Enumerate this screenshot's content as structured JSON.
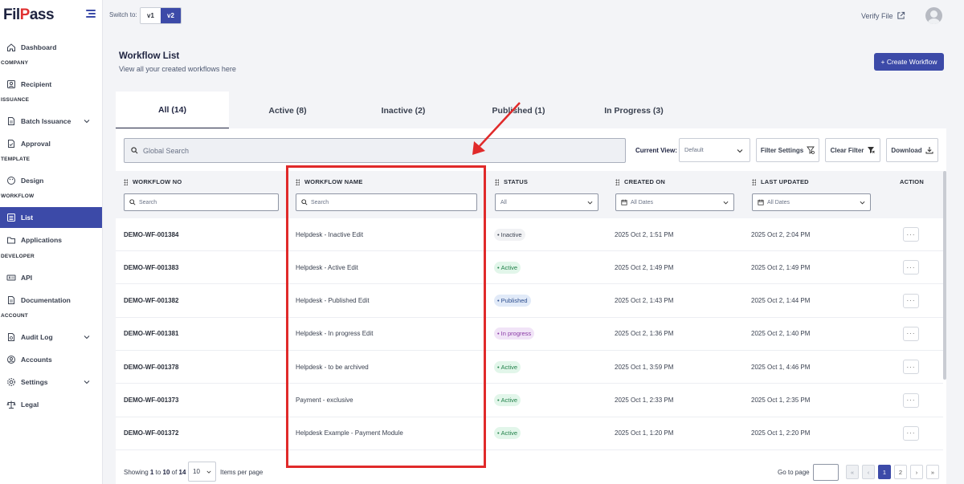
{
  "app": {
    "logo_main": "Fil",
    "logo_v": "P",
    "logo_rest": "ass"
  },
  "topbar": {
    "switch_label": "Switch to:",
    "versions": [
      "v1",
      "v2"
    ],
    "active_version": "v2",
    "verify_label": "Verify File"
  },
  "sidebar": {
    "items": [
      {
        "label": "Dashboard",
        "icon": "home-icon"
      },
      {
        "section": "COMPANY"
      },
      {
        "label": "Recipient",
        "icon": "recipient-icon"
      },
      {
        "section": "ISSUANCE"
      },
      {
        "label": "Batch Issuance",
        "icon": "document-icon",
        "expandable": true
      },
      {
        "label": "Approval",
        "icon": "document-check-icon"
      },
      {
        "section": "TEMPLATE"
      },
      {
        "label": "Design",
        "icon": "palette-icon"
      },
      {
        "section": "WORKFLOW"
      },
      {
        "label": "List",
        "icon": "list-icon",
        "active": true
      },
      {
        "label": "Applications",
        "icon": "folder-icon"
      },
      {
        "section": "DEVELOPER"
      },
      {
        "label": "API",
        "icon": "api-icon"
      },
      {
        "label": "Documentation",
        "icon": "document-icon"
      },
      {
        "section": "ACCOUNT"
      },
      {
        "label": "Audit Log",
        "icon": "audit-icon",
        "expandable": true
      },
      {
        "label": "Accounts",
        "icon": "accounts-icon"
      },
      {
        "label": "Settings",
        "icon": "gear-icon",
        "expandable": true
      },
      {
        "label": "Legal",
        "icon": "scale-icon"
      }
    ]
  },
  "header": {
    "title": "Workflow List",
    "subtitle": "View all your created workflows here",
    "create_label": "+ Create Workflow"
  },
  "tabs": [
    {
      "label": "All (14)",
      "active": true
    },
    {
      "label": "Active (8)"
    },
    {
      "label": "Inactive (2)"
    },
    {
      "label": "Published (1)"
    },
    {
      "label": "In Progress (3)"
    }
  ],
  "toolbar": {
    "search_placeholder": "Global Search",
    "current_view_label": "Current View:",
    "current_view_value": "Default",
    "filter_settings_label": "Filter Settings",
    "clear_filter_label": "Clear Filter",
    "download_label": "Download"
  },
  "table": {
    "columns": [
      "WORKFLOW NO",
      "WORKFLOW NAME",
      "STATUS",
      "CREATED ON",
      "LAST UPDATED",
      "ACTION"
    ],
    "filters": {
      "no_placeholder": "Search",
      "name_placeholder": "Search",
      "status_value": "All",
      "created_value": "All Dates",
      "updated_value": "All Dates"
    },
    "rows": [
      {
        "no": "DEMO-WF-001384",
        "name": "Helpdesk - Inactive Edit",
        "status": "Inactive",
        "status_kind": "inactive",
        "created": "2025 Oct 2, 1:51 PM",
        "updated": "2025 Oct 2, 2:04 PM",
        "action": "···"
      },
      {
        "no": "DEMO-WF-001383",
        "name": "Helpdesk - Active Edit",
        "status": "Active",
        "status_kind": "active",
        "created": "2025 Oct 2, 1:49 PM",
        "updated": "2025 Oct 2, 1:49 PM",
        "action": "···"
      },
      {
        "no": "DEMO-WF-001382",
        "name": "Helpdesk - Published Edit",
        "status": "Published",
        "status_kind": "published",
        "created": "2025 Oct 2, 1:43 PM",
        "updated": "2025 Oct 2, 1:44 PM",
        "action": "···"
      },
      {
        "no": "DEMO-WF-001381",
        "name": "Helpdesk - In progress Edit",
        "status": "In progress",
        "status_kind": "progress",
        "created": "2025 Oct 2, 1:36 PM",
        "updated": "2025 Oct 2, 1:40 PM",
        "action": "···"
      },
      {
        "no": "DEMO-WF-001378",
        "name": "Helpdesk - to be archived",
        "status": "Active",
        "status_kind": "active",
        "created": "2025 Oct 1, 3:59 PM",
        "updated": "2025 Oct 1, 4:46 PM",
        "action": "···"
      },
      {
        "no": "DEMO-WF-001373",
        "name": "Payment - exclusive",
        "status": "Active",
        "status_kind": "active",
        "created": "2025 Oct 1, 2:33 PM",
        "updated": "2025 Oct 1, 2:35 PM",
        "action": "···"
      },
      {
        "no": "DEMO-WF-001372",
        "name": "Helpdesk Example - Payment Module",
        "status": "Active",
        "status_kind": "active",
        "created": "2025 Oct 1, 1:20 PM",
        "updated": "2025 Oct 1, 2:20 PM",
        "action": "···"
      }
    ]
  },
  "footer": {
    "showing_prefix": "Showing ",
    "showing_from": "1",
    "showing_to_word": " to ",
    "showing_to": "10",
    "showing_of_word": " of ",
    "showing_total": "14",
    "per_page_value": "10",
    "per_page_label": "Items per page",
    "goto_label": "Go to page",
    "pages": [
      "«",
      "‹",
      "1",
      "2",
      "›",
      "»"
    ],
    "current_page": "1"
  },
  "colors": {
    "brand": "#3c4aa8",
    "annotation": "#e02a2a"
  }
}
